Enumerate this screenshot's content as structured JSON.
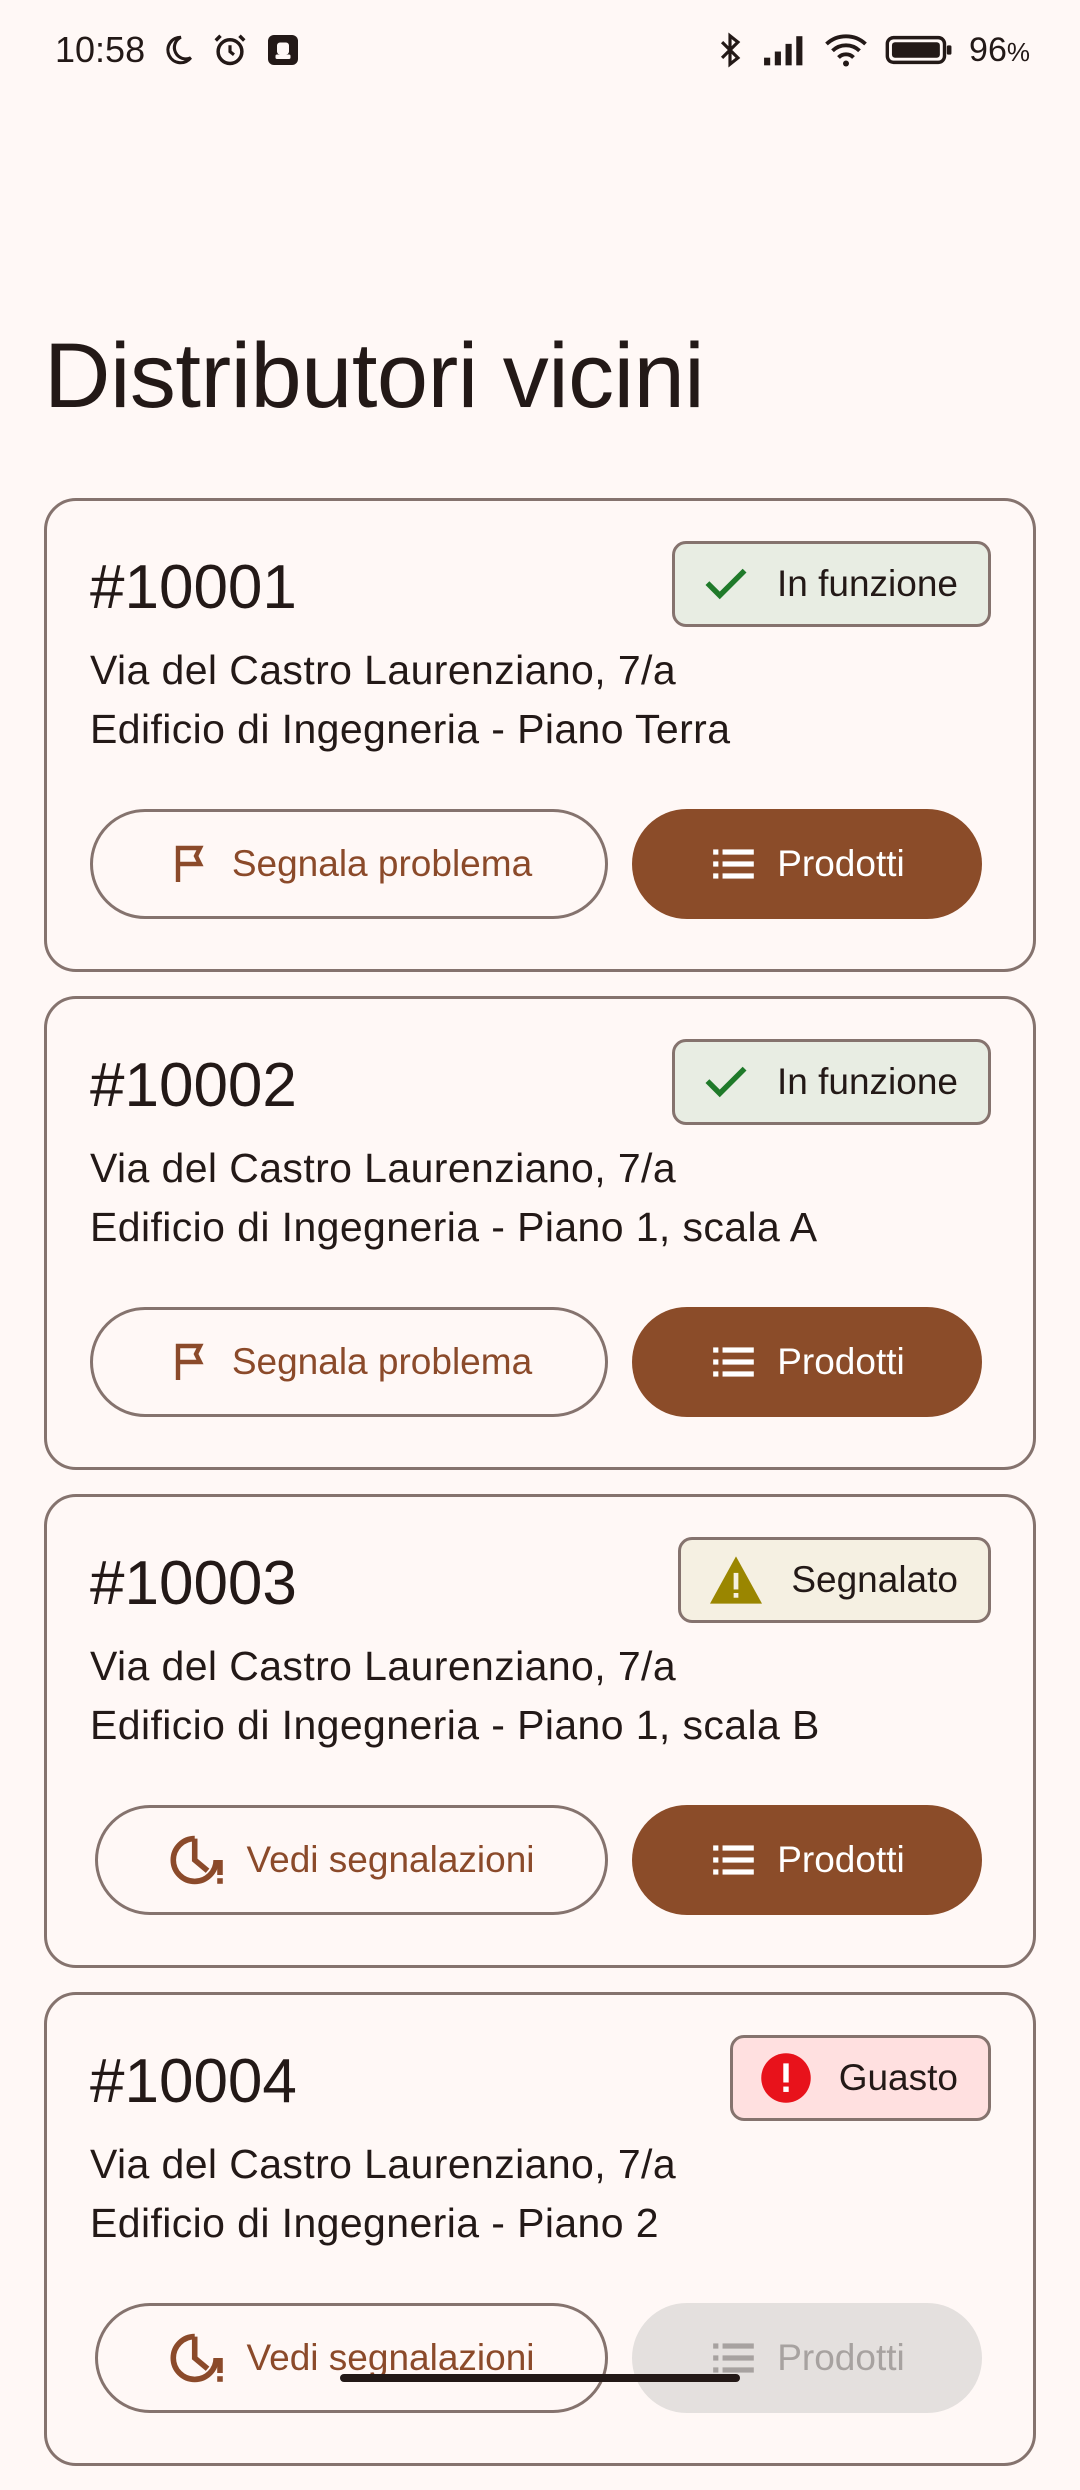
{
  "status_bar": {
    "time": "10:58",
    "battery": "96",
    "battery_unit": "%",
    "icons_left": [
      "moon-icon",
      "alarm-icon",
      "notification-app-icon"
    ],
    "icons_right": [
      "bluetooth-icon",
      "signal-icon",
      "wifi-icon",
      "battery-icon"
    ]
  },
  "page": {
    "title": "Distributori vicini"
  },
  "colors": {
    "primary": "#8b4c29",
    "ok": "#1f7a2a",
    "warn": "#9a8600",
    "error": "#e8121b",
    "outline": "#85736e"
  },
  "distributors": [
    {
      "id": "#10001",
      "address_line1": "Via del Castro Laurenziano, 7/a",
      "address_line2": "Edificio di Ingegneria - Piano Terra",
      "status": "In funzione",
      "status_icon": "check-icon",
      "secondary_action": "Segnala problema",
      "secondary_icon": "flag-icon",
      "primary_action": "Prodotti",
      "primary_icon": "list-icon"
    },
    {
      "id": "#10002",
      "address_line1": "Via del Castro Laurenziano, 7/a",
      "address_line2": "Edificio di Ingegneria - Piano 1, scala A",
      "status": "In funzione",
      "status_icon": "check-icon",
      "secondary_action": "Segnala problema",
      "secondary_icon": "flag-icon",
      "primary_action": "Prodotti",
      "primary_icon": "list-icon"
    },
    {
      "id": "#10003",
      "address_line1": "Via del Castro Laurenziano, 7/a",
      "address_line2": "Edificio di Ingegneria - Piano 1, scala B",
      "status": "Segnalato",
      "status_icon": "warning-icon",
      "secondary_action": "Vedi segnalazioni",
      "secondary_icon": "pending-report-icon",
      "primary_action": "Prodotti",
      "primary_icon": "list-icon"
    },
    {
      "id": "#10004",
      "address_line1": "Via del Castro Laurenziano, 7/a",
      "address_line2": "Edificio di Ingegneria - Piano 2",
      "status": "Guasto",
      "status_icon": "error-icon",
      "secondary_action": "Vedi segnalazioni",
      "secondary_icon": "pending-report-icon",
      "primary_action": "Prodotti",
      "primary_icon": "list-icon",
      "primary_disabled": true
    }
  ]
}
